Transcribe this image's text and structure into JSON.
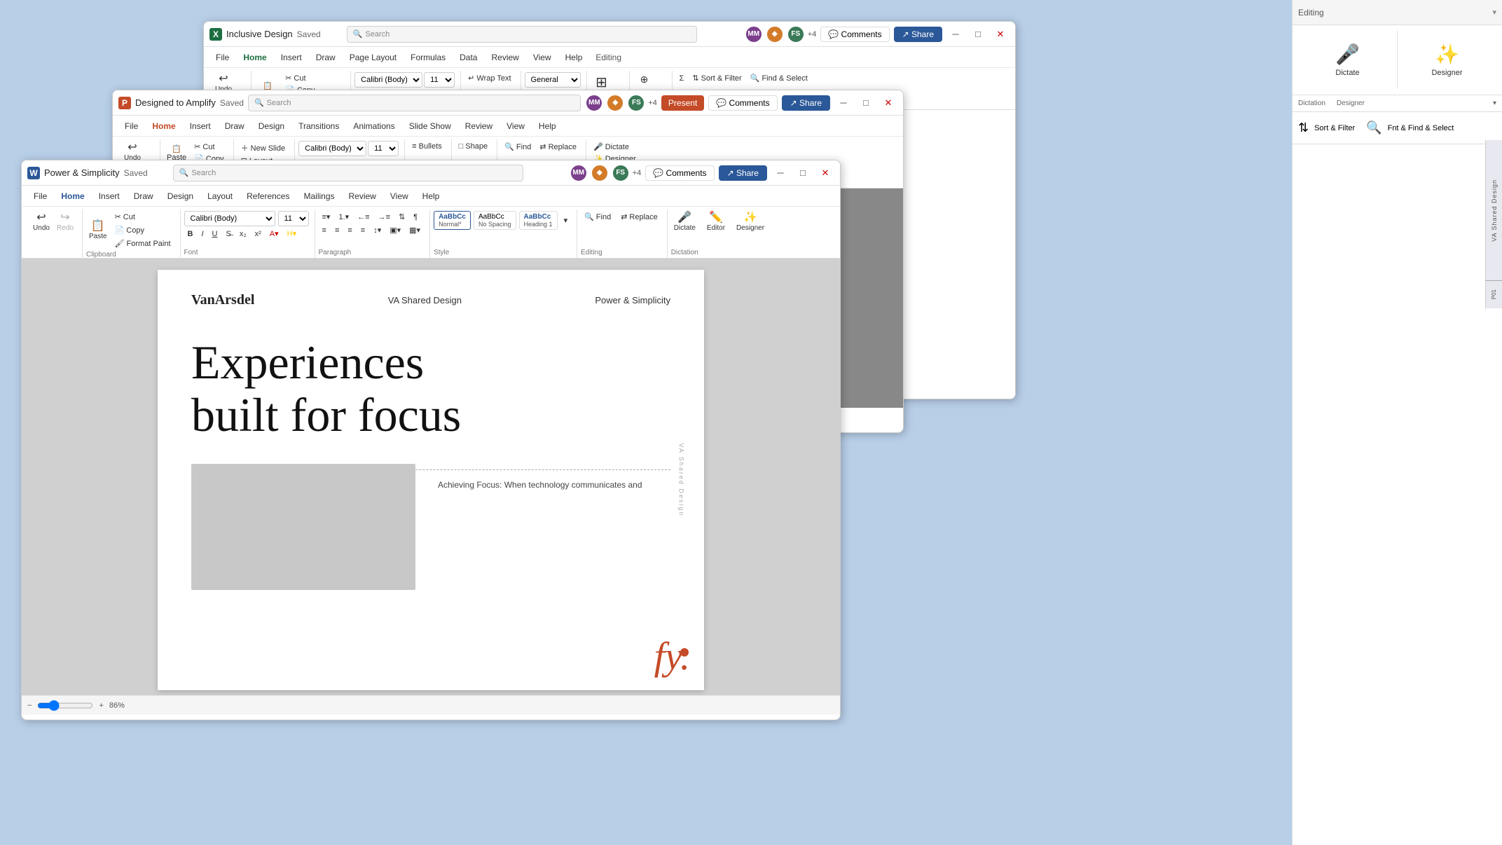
{
  "windows": {
    "excel": {
      "title": "Inclusive Design",
      "saved": "Saved",
      "search_placeholder": "Search",
      "menus": [
        "File",
        "Home",
        "Insert",
        "Draw",
        "Page Layout",
        "Formulas",
        "Data",
        "Review",
        "View",
        "Help"
      ],
      "active_menu": "Home",
      "editing_label": "Editing"
    },
    "ppt": {
      "title": "Designed to Amplify",
      "saved": "Saved",
      "search_placeholder": "Search",
      "menus": [
        "File",
        "Home",
        "Insert",
        "Draw",
        "Design",
        "Transitions",
        "Animations",
        "Slide Show",
        "Review",
        "View",
        "Help"
      ],
      "active_menu": "Home",
      "present_label": "Present",
      "comments_label": "Comments",
      "share_label": "Share"
    },
    "word": {
      "title": "Power & Simplicity",
      "saved": "Saved",
      "search_placeholder": "Search",
      "menus": [
        "File",
        "Home",
        "Insert",
        "Draw",
        "Design",
        "Layout",
        "References",
        "Mailings",
        "Review",
        "View",
        "Help"
      ],
      "active_menu": "Home",
      "comments_label": "Comments",
      "share_label": "Share"
    }
  },
  "ribbon_word": {
    "undo": "Undo",
    "redo": "Redo",
    "paste": "Paste",
    "cut": "Cut",
    "copy": "Copy",
    "format_paint": "Format Paint",
    "font_name": "Calibri (Body)",
    "font_size": "11",
    "styles": [
      "Normal*",
      "No Spacing",
      "Heading 1"
    ],
    "find": "Find",
    "replace": "Replace",
    "dictate": "Dictate",
    "editor": "Editor",
    "designer": "Designer",
    "clipboard_label": "Clipboard",
    "font_label": "Font",
    "paragraph_label": "Paragraph",
    "style_label": "Style",
    "editing_label": "Editing",
    "dictation_label": "Dictation",
    "editor_label": "Editor",
    "designer_label": "Designer"
  },
  "document": {
    "brand": "VanArsdel",
    "nav_center": "VA Shared Design",
    "nav_right": "Power & Simplicity",
    "heading_line1": "Experiences",
    "heading_line2": "built for focus",
    "body_title": "Achieving Focus: When technology communicates and",
    "dotted_line": true
  },
  "right_panel": {
    "dictate_label": "Dictate",
    "dictation_label": "Dictation",
    "designer_label": "Designer",
    "editing_label": "Editing",
    "sort_filter_label": "Sort & Filter",
    "fnt_find_label": "Fnt & Find & Select",
    "vertical_text": "VA Shared Design",
    "page_label": "P01"
  },
  "zoom": {
    "level": "86%"
  },
  "avatars": {
    "mm": "MM",
    "orange": "◆",
    "green": "FS",
    "blue": "+4"
  },
  "ppt_slide": {
    "search_placeholder": "Search"
  }
}
